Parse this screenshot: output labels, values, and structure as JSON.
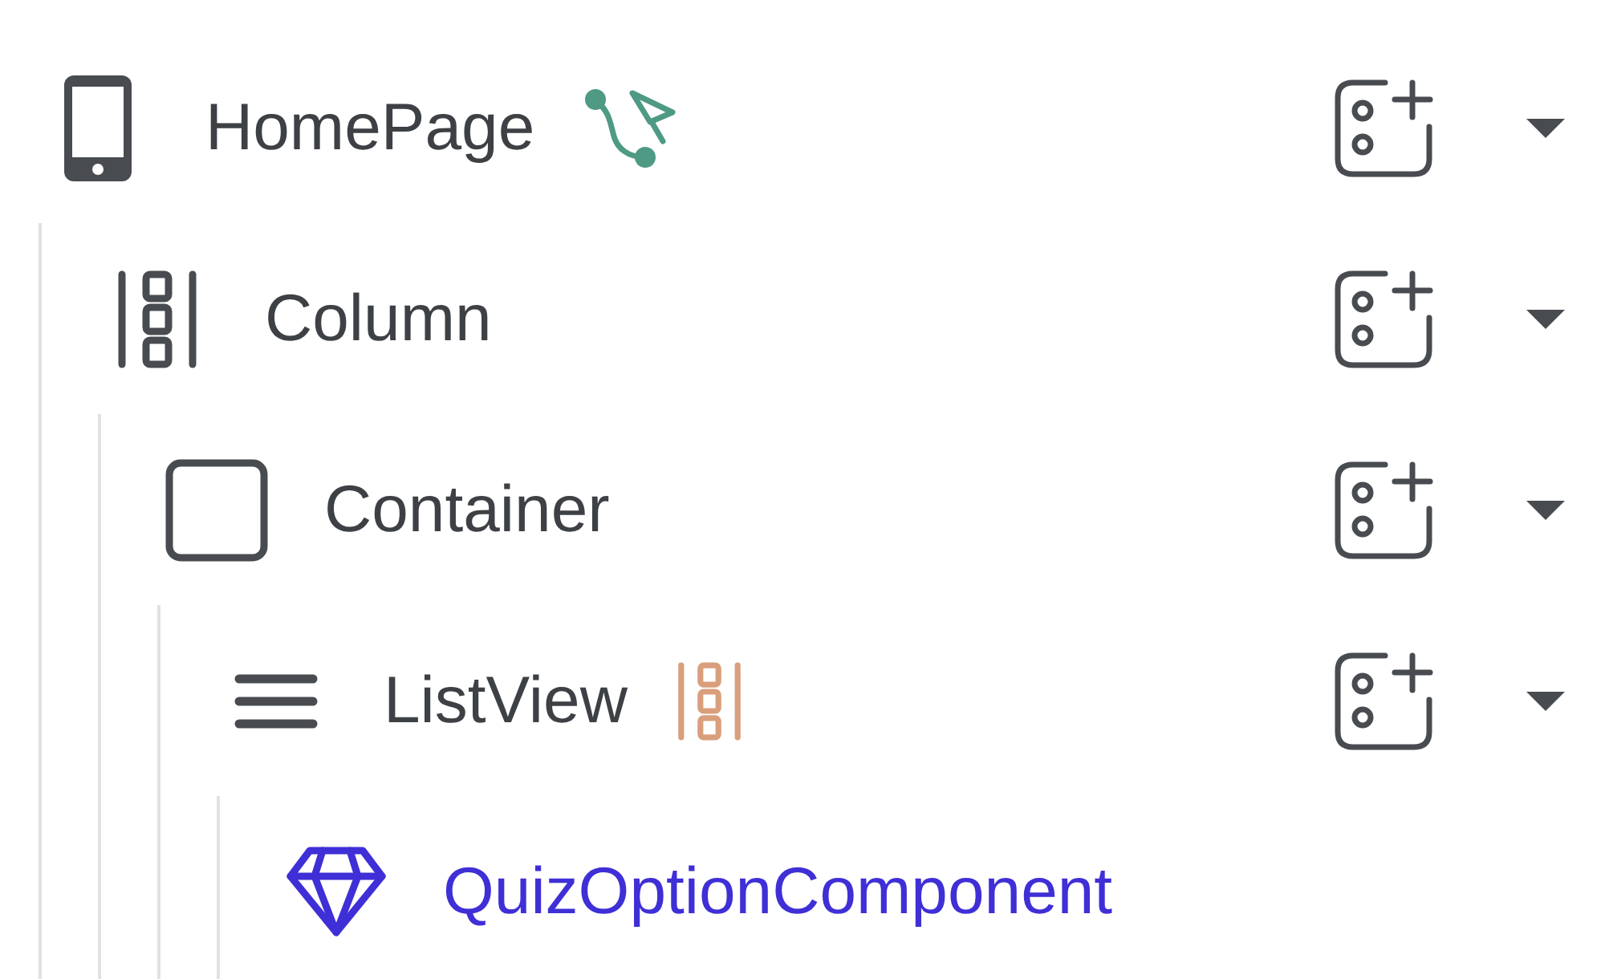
{
  "tree": [
    {
      "name": "HomePage",
      "kind": "page",
      "badge": {
        "kind": "action-flow"
      },
      "children": [
        {
          "name": "Column",
          "kind": "column",
          "children": [
            {
              "name": "Container",
              "kind": "container",
              "children": [
                {
                  "name": "ListView",
                  "kind": "listview",
                  "badge": {
                    "kind": "generated-children"
                  },
                  "children": [
                    {
                      "name": "QuizOptionComponent",
                      "kind": "component"
                    }
                  ]
                }
              ]
            }
          ]
        }
      ]
    }
  ]
}
